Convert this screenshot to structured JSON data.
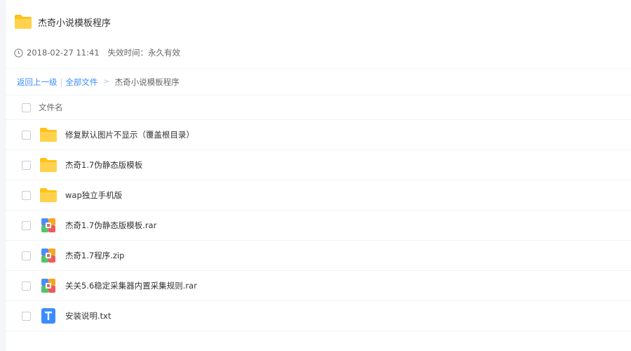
{
  "share": {
    "title": "杰奇小说模板程序",
    "date": "2018-02-27 11:41",
    "expiry": "失效时间：永久有效"
  },
  "breadcrumb": {
    "back": "返回上一级",
    "divider": "|",
    "all_files": "全部文件",
    "arrow": ">",
    "current": "杰奇小说模板程序"
  },
  "list": {
    "header": "文件名",
    "items": [
      {
        "name": "修复默认图片不显示（覆盖根目录）",
        "icon": "folder-icon"
      },
      {
        "name": "杰奇1.7伪静态版模板",
        "icon": "folder-icon"
      },
      {
        "name": "wap独立手机版",
        "icon": "folder-icon"
      },
      {
        "name": "杰奇1.7伪静态版模板.rar",
        "icon": "archive-icon"
      },
      {
        "name": "杰奇1.7程序.zip",
        "icon": "archive-icon"
      },
      {
        "name": "关关5.6稳定采集器内置采集规则.rar",
        "icon": "archive-icon"
      },
      {
        "name": "安装说明.txt",
        "icon": "text-file-icon"
      }
    ]
  },
  "colors": {
    "folder": "#ffcb3a",
    "link": "#3b8cff",
    "text_file": "#3b8cff"
  }
}
